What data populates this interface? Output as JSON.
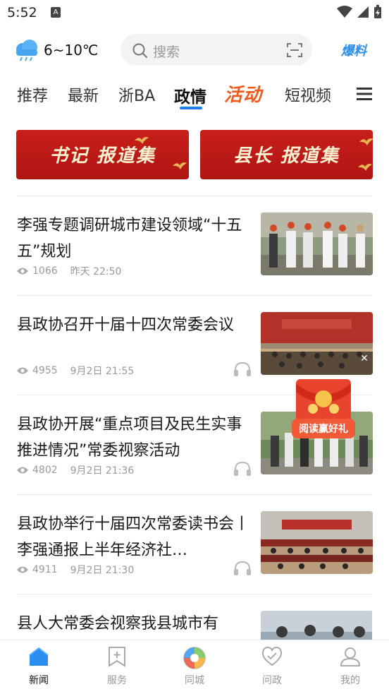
{
  "status_bar": {
    "time": "5:52",
    "notif_icon": "A"
  },
  "header": {
    "temperature": "6~10℃",
    "search_placeholder": "搜索",
    "baoliao": "爆料"
  },
  "tabs": [
    {
      "label": "推荐"
    },
    {
      "label": "最新"
    },
    {
      "label": "浙BA"
    },
    {
      "label": "政情",
      "active": true
    },
    {
      "label": "活动",
      "special": true
    },
    {
      "label": "短视频"
    }
  ],
  "banners": [
    {
      "label": "书记 报道集"
    },
    {
      "label": "县长 报道集"
    }
  ],
  "news": [
    {
      "title": "李强专题调研城市建设领域“十五五”规划",
      "views": "1066",
      "time": "昨天 22:50",
      "audio": false
    },
    {
      "title": "县政协召开十届十四次常委会议",
      "views": "4955",
      "time": "9月2日 21:55",
      "audio": true
    },
    {
      "title": "县政协开展“重点项目及民生实事推进情况”常委视察活动",
      "views": "4802",
      "time": "9月2日 21:36",
      "audio": true
    },
    {
      "title": "县政协举行十届四次常委读书会丨李强通报上半年经济社…",
      "views": "4911",
      "time": "9月2日 21:30",
      "audio": true
    },
    {
      "title": "县人大常委会视察我县城市有",
      "views": "",
      "time": "",
      "audio": false
    }
  ],
  "redpacket": {
    "label": "阅读赢好礼",
    "close": "✕"
  },
  "bottom_nav": [
    {
      "label": "新闻",
      "icon": "home-icon",
      "active": true
    },
    {
      "label": "服务",
      "icon": "bookmark-plus-icon"
    },
    {
      "label": "同城",
      "icon": "aperture-icon"
    },
    {
      "label": "问政",
      "icon": "heart-icon"
    },
    {
      "label": "我的",
      "icon": "user-icon"
    }
  ],
  "colors": {
    "accent": "#1f7ff0",
    "banner_red": "#c01a16",
    "activity_orange": "#f05a1e"
  }
}
